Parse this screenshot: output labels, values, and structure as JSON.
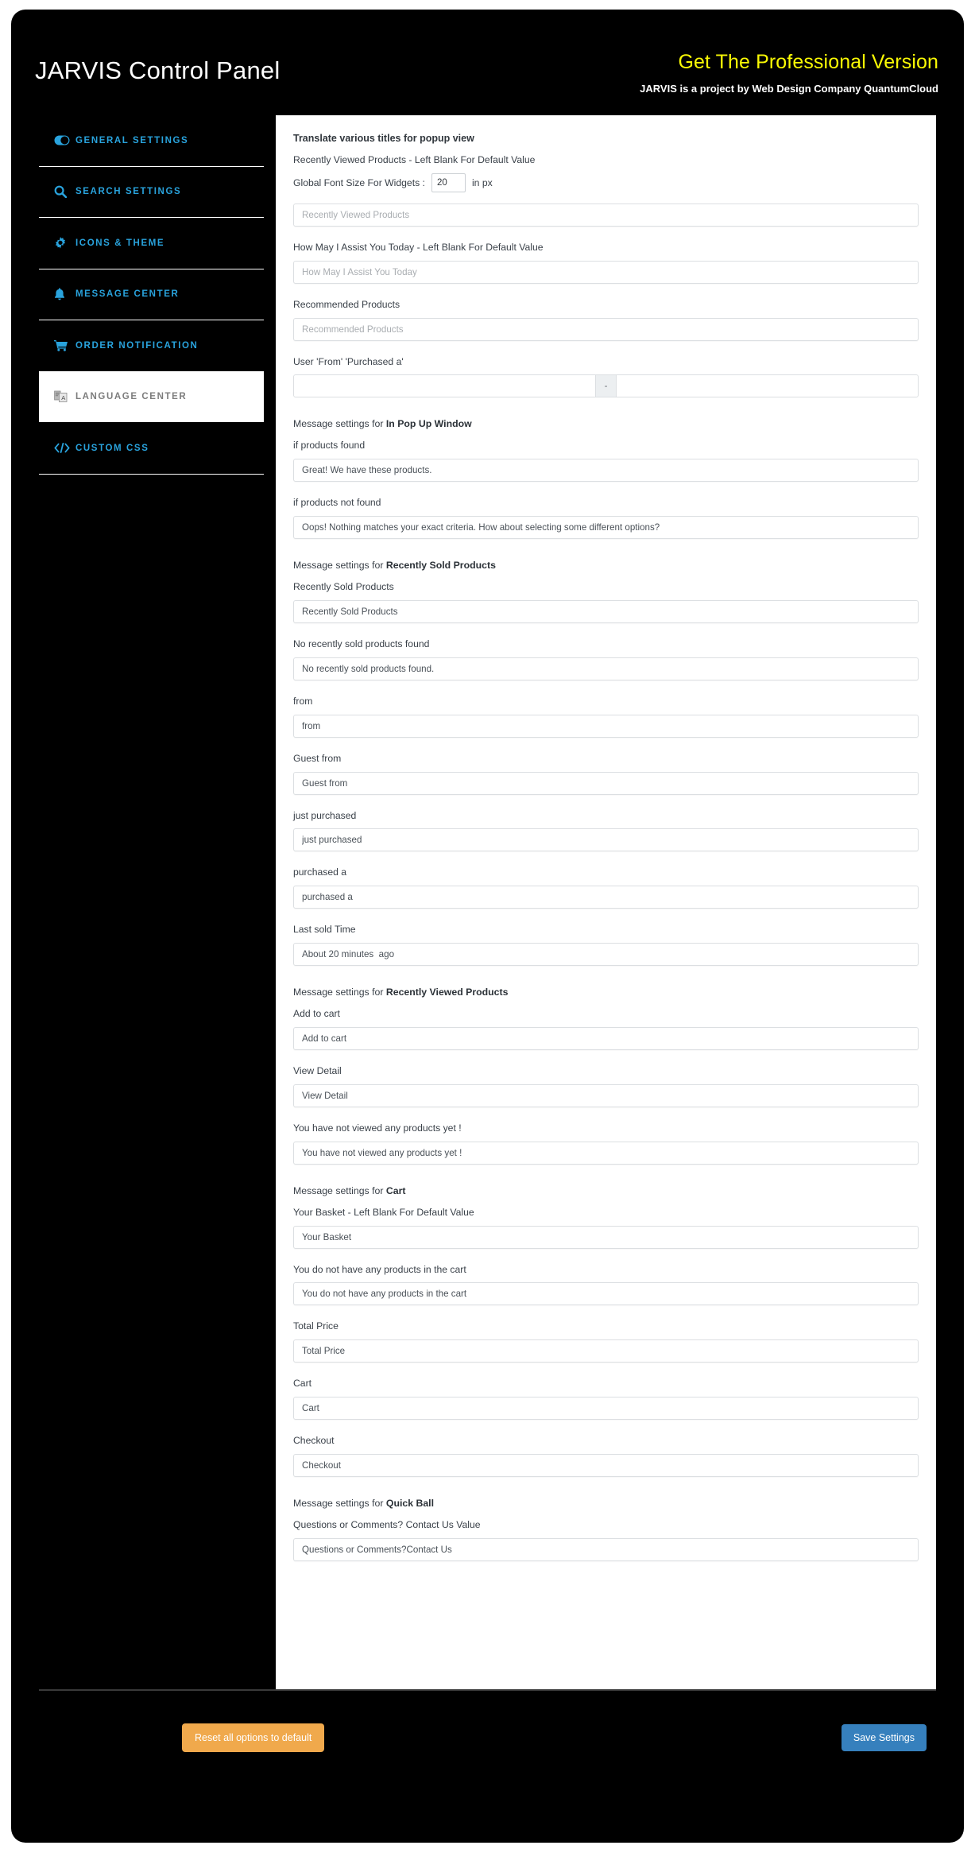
{
  "header": {
    "brand_title": "JARVIS Control Panel",
    "pro_link": "Get The Professional Version",
    "credit": "JARVIS is a project by Web Design Company QuantumCloud"
  },
  "sidebar": {
    "items": [
      {
        "label": "GENERAL SETTINGS",
        "icon": "toggle-icon",
        "active": false
      },
      {
        "label": "SEARCH SETTINGS",
        "icon": "search-icon",
        "active": false
      },
      {
        "label": "ICONS & THEME",
        "icon": "gear-icon",
        "active": false
      },
      {
        "label": "MESSAGE CENTER",
        "icon": "bell-icon",
        "active": false
      },
      {
        "label": "ORDER NOTIFICATION",
        "icon": "cart-icon",
        "active": false
      },
      {
        "label": "LANGUAGE CENTER",
        "icon": "language-icon",
        "active": true
      },
      {
        "label": "CUSTOM CSS",
        "icon": "code-icon",
        "active": false
      }
    ]
  },
  "content": {
    "section_title": "Translate various titles for popup view",
    "recently_viewed_label": "Recently Viewed Products - Left Blank For Default Value",
    "font_size": {
      "label": "Global Font Size For Widgets :",
      "value": "20",
      "unit": "in px"
    },
    "recently_viewed_placeholder": "Recently Viewed Products",
    "assist_label": "How May I Assist You Today - Left Blank For Default Value",
    "assist_placeholder": "How May I Assist You Today",
    "recommended_label": "Recommended Products",
    "recommended_placeholder": "Recommended Products",
    "user_from_label": "User 'From' 'Purchased a'",
    "user_from_left_value": "",
    "user_from_separator": "-",
    "user_from_right_value": "",
    "popup": {
      "heading_prefix": "Message settings for ",
      "heading_bold": "In Pop Up Window",
      "found_label": "if products found",
      "found_value": "Great! We have these products.",
      "not_found_label": "if products not found",
      "not_found_value": "Oops! Nothing matches your exact criteria. How about selecting some different options?"
    },
    "sold": {
      "heading_prefix": "Message settings for ",
      "heading_bold": "Recently Sold Products",
      "rows": [
        {
          "label": "Recently Sold Products",
          "value": "Recently Sold Products"
        },
        {
          "label": "No recently sold products found",
          "value": "No recently sold products found."
        },
        {
          "label": "from",
          "value": "from"
        },
        {
          "label": "Guest from",
          "value": "Guest from"
        },
        {
          "label": "just purchased",
          "value": "just purchased"
        },
        {
          "label": "purchased a",
          "value": "purchased a"
        },
        {
          "label": "Last sold Time",
          "value": "About 20 minutes  ago"
        }
      ]
    },
    "viewed": {
      "heading_prefix": "Message settings for ",
      "heading_bold": "Recently Viewed Products",
      "rows": [
        {
          "label": "Add to cart",
          "value": "Add to cart"
        },
        {
          "label": "View Detail",
          "value": "View Detail"
        },
        {
          "label": "You have not viewed any products yet !",
          "value": "You have not viewed any products yet !"
        }
      ]
    },
    "cart": {
      "heading_prefix": "Message settings for ",
      "heading_bold": "Cart",
      "rows": [
        {
          "label": "Your Basket - Left Blank For Default Value",
          "value": "Your Basket"
        },
        {
          "label": "You do not have any products in the cart",
          "value": "You do not have any products in the cart"
        },
        {
          "label": "Total Price",
          "value": "Total Price"
        },
        {
          "label": "Cart",
          "value": "Cart"
        },
        {
          "label": "Checkout",
          "value": "Checkout"
        }
      ]
    },
    "quickball": {
      "heading_prefix": "Message settings for ",
      "heading_bold": "Quick Ball",
      "rows": [
        {
          "label": "Questions or Comments? Contact Us Value",
          "value": "Questions or Comments?Contact Us"
        }
      ]
    }
  },
  "footer": {
    "reset_label": "Reset all options to default",
    "save_label": "Save Settings"
  },
  "colors": {
    "accent_blue": "#29a3dd",
    "pro_yellow": "#f9f904",
    "reset_orange": "#f0a94c",
    "save_blue": "#3680bd"
  }
}
